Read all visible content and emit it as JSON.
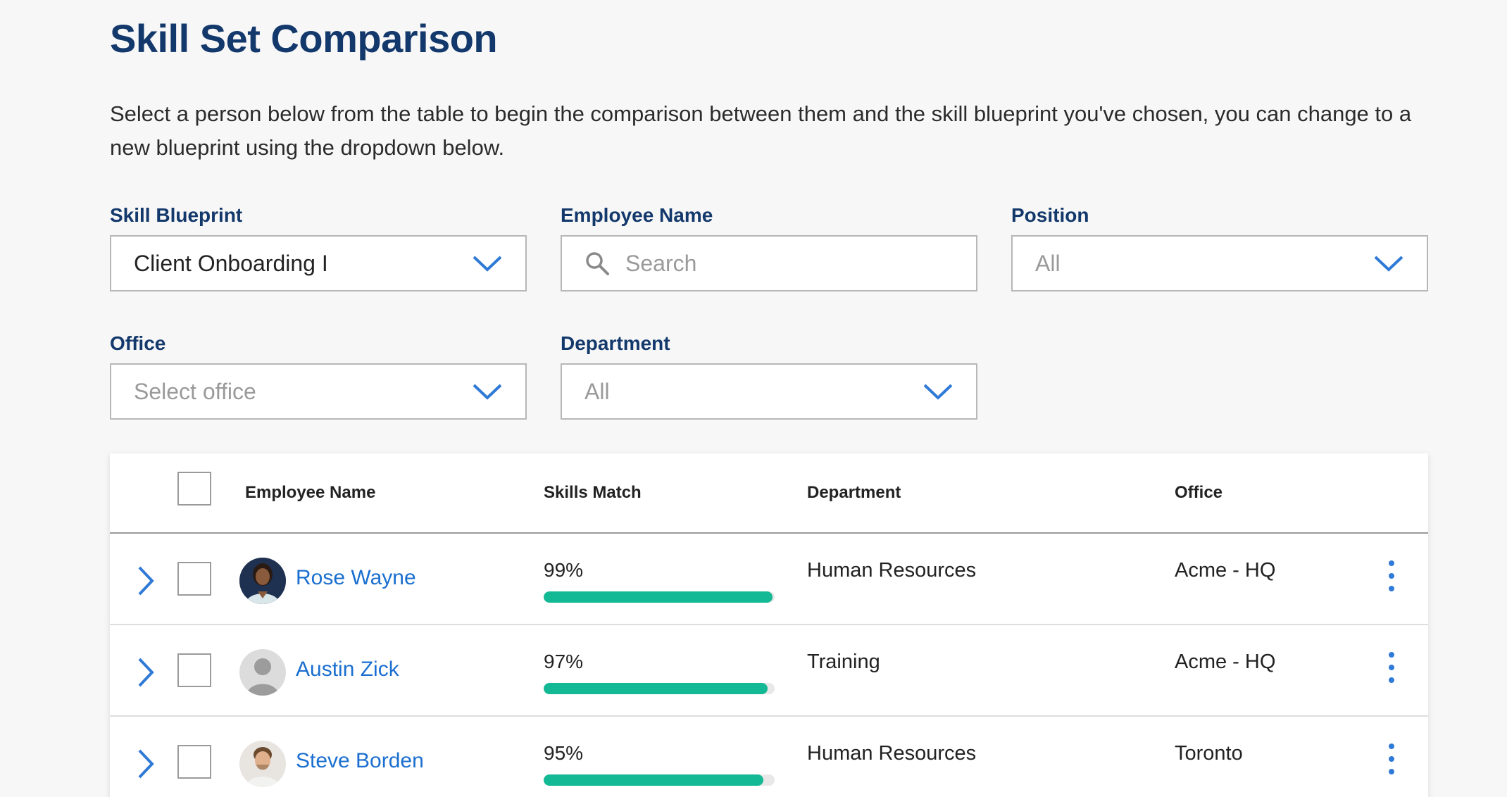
{
  "page": {
    "title": "Skill Set Comparison",
    "intro": "Select a person below from the table to begin the comparison between them and the skill blueprint you've chosen, you can change to a new blueprint using the dropdown below."
  },
  "filters": {
    "skill_blueprint": {
      "label": "Skill Blueprint",
      "value": "Client Onboarding I"
    },
    "employee_name": {
      "label": "Employee Name",
      "placeholder": "Search"
    },
    "position": {
      "label": "Position",
      "value": "All"
    },
    "office": {
      "label": "Office",
      "placeholder": "Select office"
    },
    "department": {
      "label": "Department",
      "value": "All"
    }
  },
  "table": {
    "columns": {
      "employee_name": "Employee Name",
      "skills_match": "Skills Match",
      "department": "Department",
      "office": "Office"
    },
    "rows": [
      {
        "name": "Rose Wayne",
        "match": "99%",
        "match_value": 0.99,
        "department": "Human Resources",
        "office": "Acme - HQ",
        "avatar": "photo-woman"
      },
      {
        "name": "Austin Zick",
        "match": "97%",
        "match_value": 0.97,
        "department": "Training",
        "office": "Acme - HQ",
        "avatar": "placeholder-person"
      },
      {
        "name": "Steve Borden",
        "match": "95%",
        "match_value": 0.95,
        "department": "Human Resources",
        "office": "Toronto",
        "avatar": "photo-man"
      }
    ]
  },
  "colors": {
    "heading": "#13386b",
    "link": "#1b6fd0",
    "progress": "#13b894",
    "accent_icon": "#2f7ad6"
  }
}
